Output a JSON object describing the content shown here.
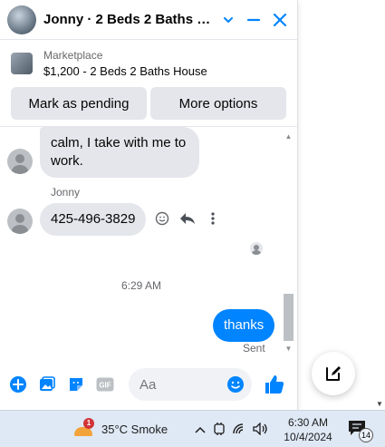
{
  "header": {
    "title": "Jonny · 2 Beds 2 Baths Ho...",
    "accent": "#0084ff"
  },
  "marketplace": {
    "label": "Marketplace",
    "listing": "$1,200 - 2 Beds 2 Baths House"
  },
  "actions": {
    "mark_pending": "Mark as pending",
    "more_options": "More options"
  },
  "thread": {
    "message1": "calm, I take with me to work.",
    "sender": "Jonny",
    "message2": "425-496-3829",
    "timestamp": "6:29 AM",
    "outgoing": "thanks",
    "status": "Sent"
  },
  "composer": {
    "placeholder": "Aa"
  },
  "taskbar": {
    "weather_badge": "1",
    "weather_text": "35°C  Smoke",
    "time": "6:30 AM",
    "date": "10/4/2024",
    "notifications": "14"
  }
}
